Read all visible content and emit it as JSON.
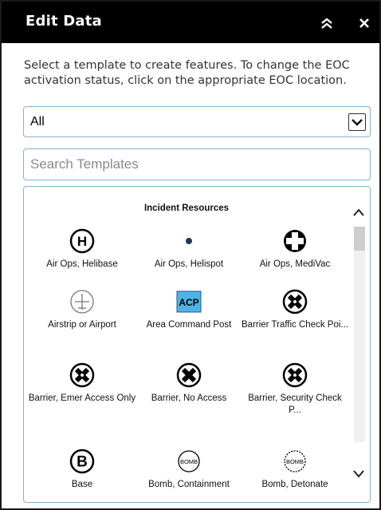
{
  "panel": {
    "title": "Edit Data",
    "collapse_icon": "double-chevron-up-icon",
    "close_icon": "close-icon"
  },
  "instructions": "Select a template to create features.  To change the EOC activation status, click on the appropriate EOC location.",
  "filter": {
    "selected": "All"
  },
  "search": {
    "placeholder": "Search Templates",
    "value": ""
  },
  "templates": {
    "group_title": "Incident Resources",
    "items": [
      {
        "label": "Air Ops, Helibase",
        "icon": "helibase-icon"
      },
      {
        "label": "Air Ops, Helispot",
        "icon": "helispot-icon"
      },
      {
        "label": "Air Ops, MediVac",
        "icon": "medivac-icon"
      },
      {
        "label": "Airstrip or Airport",
        "icon": "airstrip-icon"
      },
      {
        "label": "Area Command Post",
        "icon": "acp-icon",
        "icon_text": "ACP"
      },
      {
        "label": "Barrier Traffic Check Poi...",
        "icon": "barrier-traffic-icon"
      },
      {
        "label": "Barrier, Emer Access Only",
        "icon": "barrier-emer-icon"
      },
      {
        "label": "Barrier, No Access",
        "icon": "barrier-no-access-icon"
      },
      {
        "label": "Barrier, Security Check P...",
        "icon": "barrier-security-icon"
      },
      {
        "label": "Base",
        "icon": "base-icon",
        "icon_text": "B"
      },
      {
        "label": "Bomb, Containment",
        "icon": "bomb-containment-icon",
        "icon_text": "BOMB"
      },
      {
        "label": "Bomb, Detonate",
        "icon": "bomb-detonate-icon",
        "icon_text": "BOMB"
      }
    ]
  },
  "colors": {
    "titlebar": "#000000",
    "field_border": "#7fb3d5",
    "helispot": "#1f3a5a",
    "acp_bg": "#4fb3e6"
  }
}
